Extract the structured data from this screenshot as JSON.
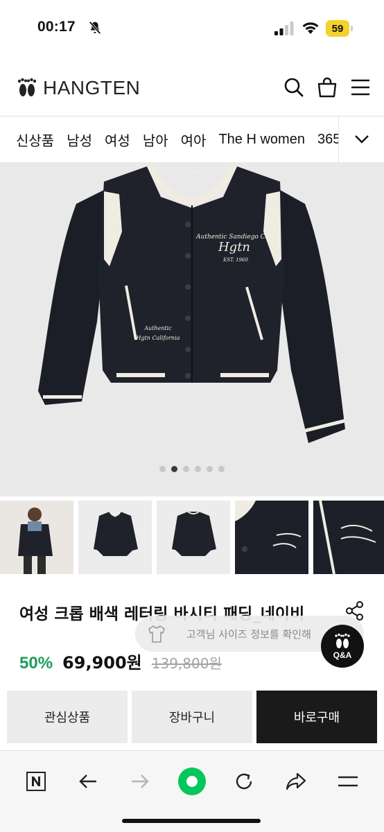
{
  "status_bar": {
    "time": "00:17",
    "battery_level": "59",
    "battery_color": "#f3d22c",
    "icons": [
      "bell-off-icon",
      "signal-icon",
      "wifi-icon",
      "battery-icon"
    ]
  },
  "header": {
    "logo_text": "HANGTEN",
    "icons": [
      "search-icon",
      "shopping-bag-icon",
      "menu-icon"
    ]
  },
  "category_nav": {
    "items": [
      "신상품",
      "남성",
      "여성",
      "남아",
      "여아",
      "The H women",
      "365"
    ],
    "expand_icon": "chevron-down-icon"
  },
  "hero": {
    "slide_count": 6,
    "active_slide_index": 1,
    "embroidery_chest_line1": "Authentic Sandiego Club",
    "embroidery_chest_line2": "Hgtn",
    "embroidery_chest_line3": "EST. 1960",
    "embroidery_pocket_line1": "Authentic",
    "embroidery_pocket_line2": "Hgtn California"
  },
  "thumbnails": [
    {
      "label": "model-photo"
    },
    {
      "label": "front-view"
    },
    {
      "label": "back-view"
    },
    {
      "label": "chest-detail"
    },
    {
      "label": "pocket-detail"
    }
  ],
  "product": {
    "title": "여성 크롭 배색 레터링 바시티 패딩_네이비",
    "discount": "50%",
    "price": "69,900원",
    "original_price": "139,800원",
    "discount_color": "#1b9d5f"
  },
  "size_banner": {
    "text": "고객님 사이즈 정보를 확인해"
  },
  "qa_button": {
    "label": "Q&A"
  },
  "actions": {
    "wishlist": "관심상품",
    "cart": "장바구니",
    "buy_now": "바로구매"
  },
  "browser_bar": {
    "icons": [
      "naver-n-icon",
      "back-arrow-icon",
      "forward-arrow-icon",
      "green-dot-icon",
      "refresh-icon",
      "share-icon",
      "menu-icon"
    ],
    "accent_color": "#03c75a"
  }
}
